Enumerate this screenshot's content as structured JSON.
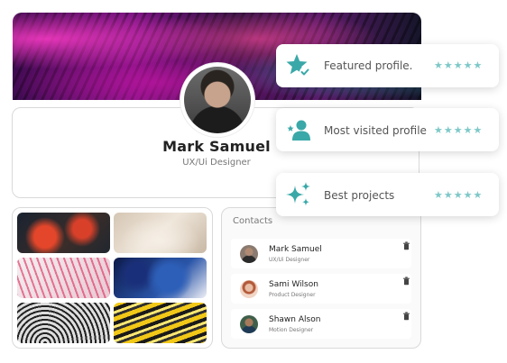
{
  "accent_color": "#3aa8a8",
  "star_color": "#7ec8c8",
  "profile": {
    "name": "Mark Samuel",
    "role": "UX/Ui Designer"
  },
  "contacts": {
    "title": "Contacts",
    "items": [
      {
        "name": "Mark Samuel",
        "role": "UX/Ui Designer"
      },
      {
        "name": "Sami Wilson",
        "role": "Product Designer"
      },
      {
        "name": "Shawn Alson",
        "role": "Motion Designer"
      }
    ]
  },
  "badges": [
    {
      "label": "Featured profile.",
      "icon": "star-check-icon",
      "stars": "★★★★★",
      "rating": 5
    },
    {
      "label": "Most visited profile",
      "icon": "users-icon",
      "stars": "★★★★★",
      "rating": 5
    },
    {
      "label": "Best projects",
      "icon": "sparkles-icon",
      "stars": "★★★★★",
      "rating": 5
    }
  ]
}
